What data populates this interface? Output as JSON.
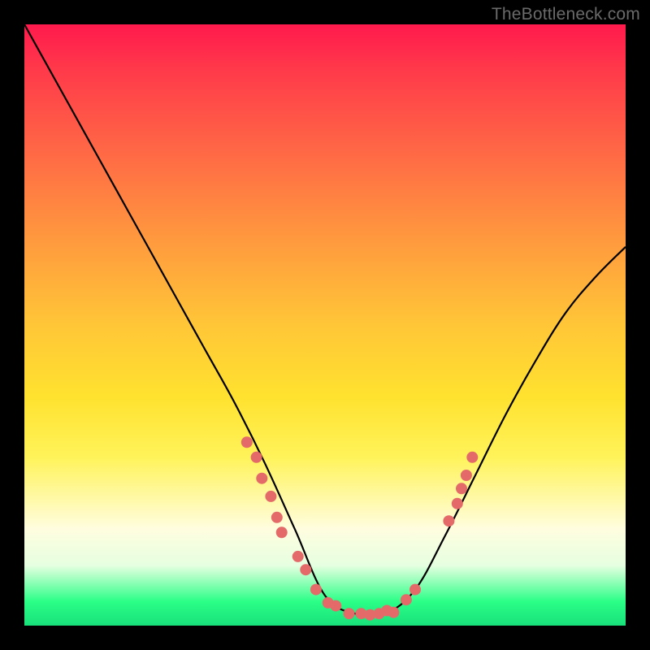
{
  "watermark": "TheBottleneck.com",
  "chart_data": {
    "type": "line",
    "title": "",
    "xlabel": "",
    "ylabel": "",
    "xlim": [
      0,
      1
    ],
    "ylim": [
      0,
      1
    ],
    "series": [
      {
        "name": "bottleneck-curve",
        "x": [
          0.0,
          0.05,
          0.1,
          0.15,
          0.2,
          0.25,
          0.3,
          0.35,
          0.4,
          0.45,
          0.5,
          0.55,
          0.6,
          0.65,
          0.7,
          0.75,
          0.8,
          0.85,
          0.9,
          0.95,
          1.0
        ],
        "y": [
          1.0,
          0.91,
          0.82,
          0.73,
          0.64,
          0.55,
          0.46,
          0.37,
          0.27,
          0.16,
          0.05,
          0.02,
          0.02,
          0.06,
          0.15,
          0.25,
          0.35,
          0.44,
          0.52,
          0.58,
          0.63
        ]
      }
    ],
    "scatter": {
      "name": "known-points",
      "color": "#e46a6a",
      "points": [
        {
          "x": 0.37,
          "y": 0.305
        },
        {
          "x": 0.386,
          "y": 0.28
        },
        {
          "x": 0.395,
          "y": 0.245
        },
        {
          "x": 0.41,
          "y": 0.215
        },
        {
          "x": 0.42,
          "y": 0.18
        },
        {
          "x": 0.428,
          "y": 0.155
        },
        {
          "x": 0.455,
          "y": 0.115
        },
        {
          "x": 0.468,
          "y": 0.093
        },
        {
          "x": 0.485,
          "y": 0.06
        },
        {
          "x": 0.505,
          "y": 0.038
        },
        {
          "x": 0.518,
          "y": 0.033
        },
        {
          "x": 0.54,
          "y": 0.02
        },
        {
          "x": 0.56,
          "y": 0.02
        },
        {
          "x": 0.575,
          "y": 0.018
        },
        {
          "x": 0.59,
          "y": 0.02
        },
        {
          "x": 0.603,
          "y": 0.025
        },
        {
          "x": 0.614,
          "y": 0.022
        },
        {
          "x": 0.635,
          "y": 0.043
        },
        {
          "x": 0.65,
          "y": 0.06
        },
        {
          "x": 0.706,
          "y": 0.174
        },
        {
          "x": 0.72,
          "y": 0.203
        },
        {
          "x": 0.727,
          "y": 0.228
        },
        {
          "x": 0.735,
          "y": 0.25
        },
        {
          "x": 0.745,
          "y": 0.28
        }
      ]
    }
  }
}
